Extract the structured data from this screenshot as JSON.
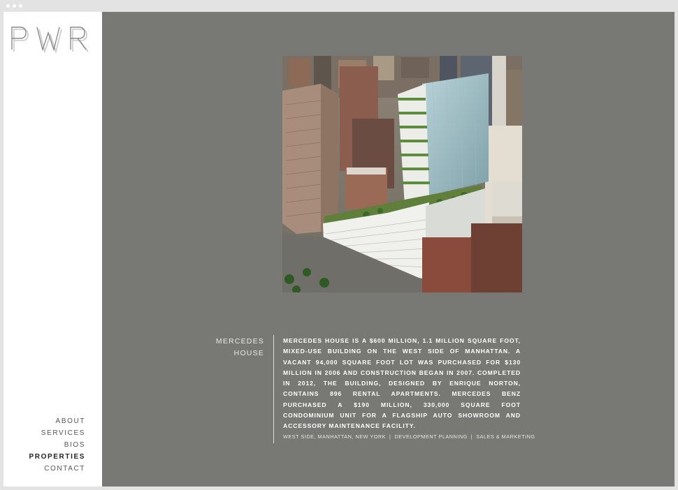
{
  "logo": {
    "text": "PWR"
  },
  "nav": {
    "items": [
      {
        "label": "ABOUT",
        "active": false
      },
      {
        "label": "SERVICES",
        "active": false
      },
      {
        "label": "BIOS",
        "active": false
      },
      {
        "label": "PROPERTIES",
        "active": true
      },
      {
        "label": "CONTACT",
        "active": false
      }
    ]
  },
  "property": {
    "title_line1": "MERCEDES",
    "title_line2": "HOUSE",
    "image_alt": "aerial-photo-mercedes-house",
    "description": "MERCEDES HOUSE IS A $600 MILLION, 1.1 MILLION SQUARE FOOT, MIXED-USE BUILDING ON THE WEST SIDE OF MANHATTAN. A VACANT 94,000 SQUARE FOOT LOT WAS PURCHASED FOR $130 MILLION IN 2006 AND CONSTRUCTION BEGAN IN 2007. COMPLETED IN 2012, THE BUILDING, DESIGNED BY ENRIQUE NORTON, CONTAINS 896 RENTAL APARTMENTS. MERCEDES BENZ PURCHASED A $190 MILLION, 330,000 SQUARE FOOT CONDOMINIUM UNIT FOR A FLAGSHIP AUTO SHOWROOM AND ACCESSORY MAINTENANCE FACILITY.",
    "tags": [
      "WEST SIDE, MANHATTAN, NEW YORK",
      "DEVELOPMENT PLANNING",
      "SALES & MARKETING"
    ],
    "tag_separator": "|"
  },
  "colors": {
    "main_background": "#787975",
    "sidebar_background": "#ffffff",
    "frame": "#e3e3e3"
  }
}
